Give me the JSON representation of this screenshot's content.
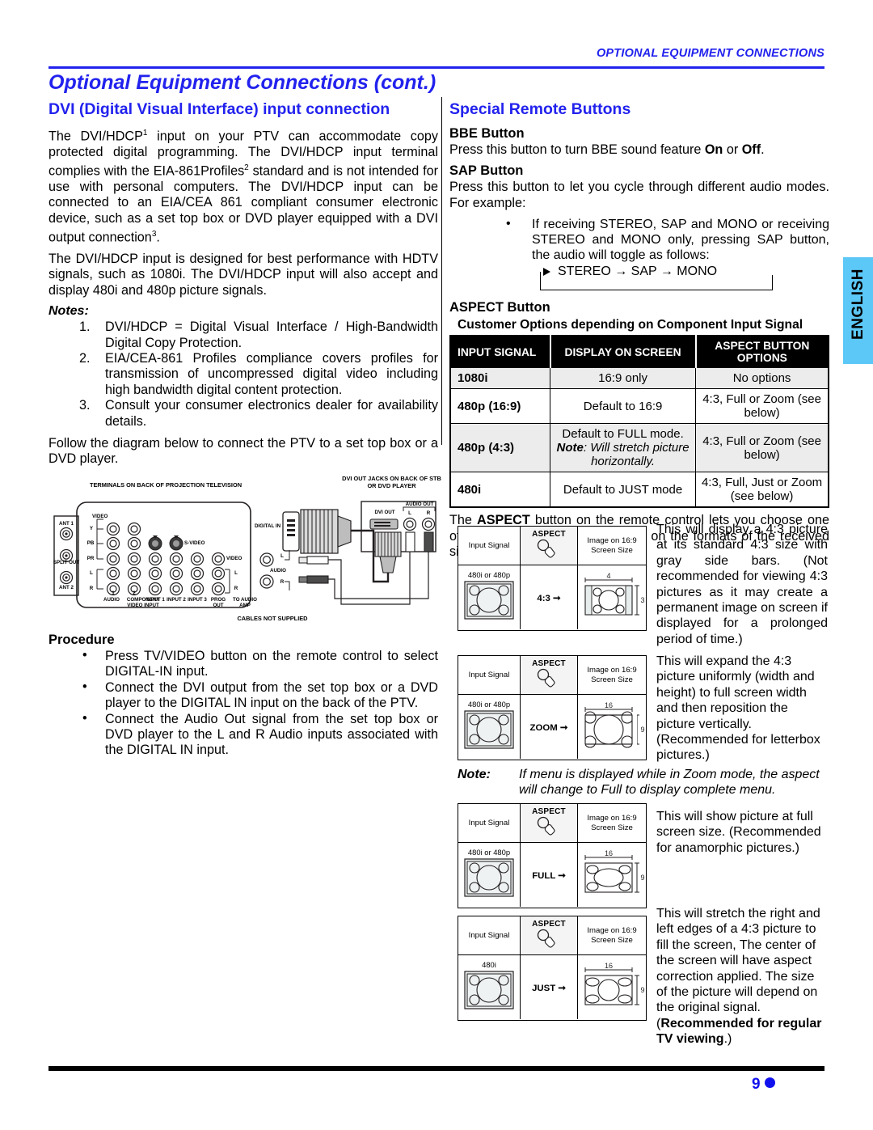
{
  "running_head": "OPTIONAL EQUIPMENT CONNECTIONS",
  "title": "Optional Equipment Connections (cont.)",
  "left": {
    "heading": "DVI (Digital Visual Interface) input connection",
    "para1_a": "The DVI/HDCP",
    "para1_sup1": "1",
    "para1_b": " input on your PTV can accommodate copy protected digital programming. The DVI/HDCP input terminal complies with the EIA-861Profiles",
    "para1_sup2": "2",
    "para1_c": " standard and is not intended for use with personal computers. The DVI/HDCP input can be connected to an EIA/CEA 861 compliant consumer electronic device, such as a set top box or DVD player equipped with a DVI output connection",
    "para1_sup3": "3",
    "para1_d": ".",
    "para2": "The DVI/HDCP input is designed for best performance with HDTV signals, such as 1080i. The DVI/HDCP input will also accept and display 480i and 480p picture signals.",
    "notes_label": "Notes:",
    "notes": [
      {
        "num": "1.",
        "text": "DVI/HDCP = Digital Visual Interface / High-Bandwidth Digital Copy Protection."
      },
      {
        "num": "2.",
        "text": "EIA/CEA-861 Profiles compliance covers profiles for transmission of uncompressed digital video including high bandwidth digital content protection."
      },
      {
        "num": "3.",
        "text": "Consult your consumer electronics dealer for availability details."
      }
    ],
    "para3": "Follow the diagram below to connect the PTV to a set top box or a DVD player.",
    "procedure_heading": "Procedure",
    "procedure": [
      "Press TV/VIDEO button on the remote control to select DIGITAL-IN input.",
      "Connect the DVI output from the set top box or a DVD player to the DIGITAL IN input on the back of the PTV.",
      "Connect the Audio Out signal from the set top box or DVD player to the L and R Audio inputs associated with the DIGITAL  IN input."
    ]
  },
  "diagram": {
    "title_tv": "TERMINALS ON BACK OF PROJECTION TELEVISION",
    "title_stb": "DVI OUT JACKS ON BACK OF STB OR DVD PLAYER",
    "cables_note": "CABLES NOT SUPPLIED",
    "ant1": "ANT 1",
    "split_out": "SPLIT OUT",
    "ant2": "ANT 2",
    "video": "VIDEO",
    "y": "Y",
    "pb": "PB",
    "pr": "PR",
    "l": "L",
    "r": "R",
    "svideo": "S-VIDEO",
    "video_jack": "VIDEO",
    "audio": "AUDIO",
    "component_video_input": "COMPONENT VIDEO INPUT",
    "n1": "1",
    "n2": "2",
    "input1": "INPUT 1",
    "input2": "INPUT 2",
    "input3": "INPUT 3",
    "prog_out": "PROG OUT",
    "to_audio_amp": "TO AUDIO AMP",
    "digital_in": "DIGITAL IN",
    "dvi_out": "DVI OUT",
    "audio_out": "AUDIO OUT",
    "lch": "L",
    "rch": "R"
  },
  "right": {
    "heading": "Special Remote Buttons",
    "bbe_heading": "BBE Button",
    "bbe_text_a": "Press this button to turn BBE sound feature ",
    "bbe_on": "On",
    "bbe_or": " or ",
    "bbe_off": "Off",
    "bbe_end": ".",
    "sap_heading": "SAP Button",
    "sap_text": "Press this button to let you cycle through different audio modes. For example:",
    "sap_bullet": "If receiving STEREO, SAP and MONO or receiving STEREO and MONO only, pressing SAP button, the audio will toggle as follows:",
    "sap_cycle": "STEREO →  SAP →  MONO",
    "aspect_heading": "ASPECT Button",
    "table_caption": "Customer Options depending on Component Input Signal",
    "table": {
      "headers": [
        "INPUT SIGNAL",
        "DISPLAY ON SCREEN",
        "ASPECT BUTTON OPTIONS"
      ],
      "rows": [
        {
          "signal": "1080i",
          "display": "16:9 only",
          "options": "No options"
        },
        {
          "signal": "480p (16:9)",
          "display": "Default to 16:9",
          "options": "4:3, Full or Zoom (see below)"
        },
        {
          "signal": "480p (4:3)",
          "display_line1": "Default to FULL mode.",
          "display_note_label": "Note",
          "display_note": ": Will stretch picture horizontally.",
          "options": "4:3, Full or Zoom (see below)"
        },
        {
          "signal": "480i",
          "display": "Default to JUST mode",
          "options": "4:3, Full, Just or Zoom (see below)"
        }
      ]
    },
    "aspect_para_a": "The ",
    "aspect_para_bold": "ASPECT",
    "aspect_para_b": " button on the remote control lets you choose one of four display modes, depending on the formats of the received signal and your preferences.",
    "illustrations": [
      {
        "col1_header": "Input Signal",
        "col2_header": "ASPECT",
        "col3_header": "Image on 16:9 Screen Size",
        "input_caption": "480i or 480p",
        "mode": "4:3",
        "width_label": "4",
        "height_label": "3"
      },
      {
        "col1_header": "Input Signal",
        "col2_header": "ASPECT",
        "col3_header": "Image on 16:9 Screen Size",
        "input_caption": "480i  or 480p",
        "mode": "ZOOM",
        "width_label": "16",
        "height_label": "9"
      },
      {
        "col1_header": "Input Signal",
        "col2_header": "ASPECT",
        "col3_header": "Image on 16:9 Screen Size",
        "input_caption": "480i  or 480p",
        "mode": "FULL",
        "width_label": "16",
        "height_label": "9"
      },
      {
        "col1_header": "Input Signal",
        "col2_header": "ASPECT",
        "col3_header": "Image on 16:9 Screen Size",
        "input_caption": "480i",
        "mode": "JUST",
        "width_label": "16",
        "height_label": "9"
      }
    ],
    "desc_43": "This will display a 4:3 picture at its standard 4:3 size with gray side bars. (Not recommended for viewing 4:3 pictures as it  may create a permanent image on screen if displayed for a prolonged period of time.)",
    "desc_zoom": "This will expand the 4:3 picture uniformly (width and height) to full screen width and then reposition the picture vertically. (Recommended for letterbox pictures.)",
    "zoom_note_label": "Note:",
    "zoom_note_text": "If menu is displayed while in Zoom mode, the aspect will change to Full to display complete menu.",
    "desc_full": "This will show picture at full screen size. (Recommended for anamorphic pictures.)",
    "desc_just_a": "This will stretch the right and left edges of a 4:3 picture to fill the screen, The center of the screen will have aspect correction applied. The size of the picture will depend on the original signal. (",
    "desc_just_bold": "Recommended for regular TV viewing",
    "desc_just_b": ".)"
  },
  "side_tab": "ENGLISH",
  "page_number": "9",
  "colors": {
    "accent": "#2222ee",
    "tab": "#5cc8f7"
  }
}
